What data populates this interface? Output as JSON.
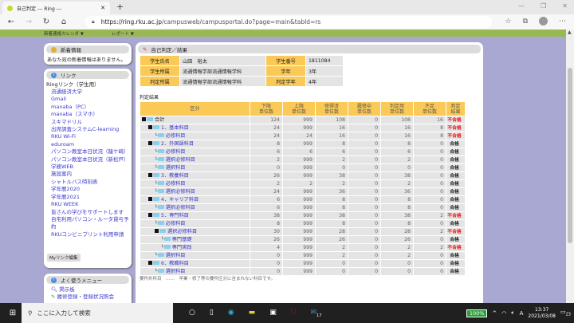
{
  "browser": {
    "tab_title": "自己判定 --- Ring ---",
    "url_host": "https://ring.rku.ac.jp",
    "url_path": "/campusweb/campusportal.do?page=main&tabId=rs"
  },
  "topnav": {
    "items": [
      "新着連絡カレンダ ▼",
      "レポート ▼"
    ]
  },
  "news": {
    "title": "新着情報",
    "message": "あなた宛の新着情報はありません。"
  },
  "links": {
    "title": "リンク",
    "group": "Ringリンク（学生用）",
    "items": [
      "流通経済大学",
      "Gmail",
      "manaba（PC）",
      "manaba（スマホ）",
      "スキマドリル",
      "出席調査システムC-learning",
      "RKU Wi-Fi",
      "eduroam",
      "パソコン教室本日状況（龍ケ崎）",
      "パソコン教室本日状況（新松戸）",
      "学務WEB",
      "施設案内",
      "シャトルバス時刻表",
      "学年暦2020",
      "学年暦2021",
      "RKU WEEK",
      "皆さんの学びをサポートします",
      "自宅利用パソコン・ルータ貸与予約",
      "RKUコンビニプリント利用申請"
    ],
    "edit_button": "Myリンク編集"
  },
  "menu": {
    "title": "よく使うメニュー",
    "items": [
      "掲示板",
      "履修登録・登録状況照会"
    ]
  },
  "main": {
    "title": "自己判定／結果",
    "info": [
      [
        "学生氏名",
        "山田　裕太",
        "学生番号",
        "1811084"
      ],
      [
        "学生所属",
        "流通情報学部流通情報学科",
        "学年",
        "3年"
      ],
      [
        "判定所属",
        "流通情報学部流通情報学科",
        "判定学年",
        "4年"
      ]
    ],
    "subtitle": "判定結果",
    "headers": [
      "区分",
      "下限\n単位数",
      "上限\n単位数",
      "修得済\n単位数",
      "履修中\n単位数",
      "判定用\n単位数",
      "不足\n単位数",
      "判定\n結果"
    ],
    "rows": [
      {
        "name": "合計",
        "depth": 0,
        "v": [
          "124",
          "999",
          "108",
          "0",
          "108",
          "16"
        ],
        "result": "不合格",
        "fail": true
      },
      {
        "name": "1．基本科目",
        "depth": 1,
        "v": [
          "24",
          "999",
          "16",
          "0",
          "16",
          "8"
        ],
        "result": "不合格",
        "fail": true
      },
      {
        "name": "必修科目",
        "depth": 2,
        "v": [
          "24",
          "24",
          "16",
          "0",
          "16",
          "8"
        ],
        "result": "不合格",
        "fail": true
      },
      {
        "name": "2．外国語科目",
        "depth": 1,
        "v": [
          "8",
          "999",
          "8",
          "0",
          "8",
          "0"
        ],
        "result": "合格",
        "fail": false
      },
      {
        "name": "必修科目",
        "depth": 2,
        "v": [
          "6",
          "6",
          "6",
          "0",
          "6",
          "0"
        ],
        "result": "合格",
        "fail": false
      },
      {
        "name": "選択必修科目",
        "depth": 2,
        "v": [
          "2",
          "999",
          "2",
          "0",
          "2",
          "0"
        ],
        "result": "合格",
        "fail": false
      },
      {
        "name": "選択科目",
        "depth": 2,
        "v": [
          "0",
          "999",
          "0",
          "0",
          "0",
          "0"
        ],
        "result": "合格",
        "fail": false
      },
      {
        "name": "3．教養科目",
        "depth": 1,
        "v": [
          "26",
          "999",
          "38",
          "0",
          "38",
          "0"
        ],
        "result": "合格",
        "fail": false
      },
      {
        "name": "必修科目",
        "depth": 2,
        "v": [
          "2",
          "2",
          "2",
          "0",
          "2",
          "0"
        ],
        "result": "合格",
        "fail": false
      },
      {
        "name": "選択必修科目",
        "depth": 2,
        "v": [
          "24",
          "999",
          "36",
          "0",
          "36",
          "0"
        ],
        "result": "合格",
        "fail": false
      },
      {
        "name": "4．キャリア科目",
        "depth": 1,
        "v": [
          "6",
          "999",
          "8",
          "0",
          "8",
          "0"
        ],
        "result": "合格",
        "fail": false
      },
      {
        "name": "選択必修科目",
        "depth": 2,
        "v": [
          "6",
          "999",
          "8",
          "0",
          "8",
          "0"
        ],
        "result": "合格",
        "fail": false
      },
      {
        "name": "5．専門科目",
        "depth": 1,
        "v": [
          "38",
          "999",
          "38",
          "0",
          "38",
          "2"
        ],
        "result": "不合格",
        "fail": true
      },
      {
        "name": "必修科目",
        "depth": 2,
        "v": [
          "8",
          "999",
          "8",
          "0",
          "8",
          "0"
        ],
        "result": "合格",
        "fail": false
      },
      {
        "name": "選択必修科目",
        "depth": 2,
        "v": [
          "30",
          "999",
          "28",
          "0",
          "28",
          "2"
        ],
        "result": "不合格",
        "fail": true
      },
      {
        "name": "専門基礎",
        "depth": 3,
        "v": [
          "26",
          "999",
          "26",
          "0",
          "26",
          "0"
        ],
        "result": "合格",
        "fail": false
      },
      {
        "name": "専門実践",
        "depth": 3,
        "v": [
          "4",
          "999",
          "2",
          "0",
          "2",
          "2"
        ],
        "result": "不合格",
        "fail": true
      },
      {
        "name": "選択科目",
        "depth": 2,
        "v": [
          "0",
          "999",
          "2",
          "0",
          "2",
          "0"
        ],
        "result": "合格",
        "fail": false
      },
      {
        "name": "6．教職科目",
        "depth": 1,
        "v": [
          "0",
          "999",
          "0",
          "0",
          "0",
          "0"
        ],
        "result": "合格",
        "fail": false
      },
      {
        "name": "選択科目",
        "depth": 2,
        "v": [
          "0",
          "999",
          "0",
          "0",
          "0",
          "0"
        ],
        "result": "合格",
        "fail": false
      }
    ],
    "footnote": "要件外科目　……　卒業・修了等の要件区分に含まれない科目です。"
  },
  "taskbar": {
    "search_placeholder": "ここに入力して検索",
    "battery": "100%",
    "time": "13:37",
    "date": "2021/03/08",
    "mail_badge": "17",
    "notif_badge": "23"
  }
}
